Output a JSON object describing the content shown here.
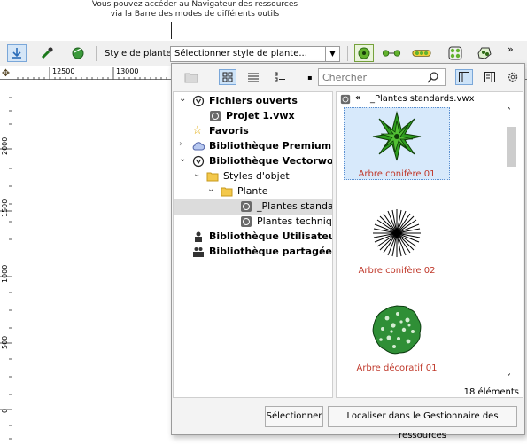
{
  "callout": {
    "line1": "Vous pouvez accéder au Navigateur des ressources",
    "line2": "via la Barre des modes de différents outils"
  },
  "toolbar": {
    "style_label": "Style de plante:",
    "style_value": "Sélectionner style de plante...",
    "overflow": "»"
  },
  "ruler": {
    "h_labels": [
      "12500",
      "13000"
    ],
    "v_labels": [
      "2000",
      "1500",
      "1000",
      "500",
      "0"
    ]
  },
  "panel": {
    "search_placeholder": "Chercher",
    "tree": [
      {
        "label": "Fichiers ouverts",
        "bold": true,
        "icon": "vectorworks-logo-icon"
      },
      {
        "label": "Projet 1.vwx",
        "bold": true,
        "icon": "vwx-file-icon"
      },
      {
        "label": "Favoris",
        "bold": true,
        "icon": "star-icon"
      },
      {
        "label": "Bibliothèque Premium",
        "bold": true,
        "icon": "cloud-icon"
      },
      {
        "label": "Bibliothèque Vectorworks",
        "bold": true,
        "icon": "vectorworks-logo-icon"
      },
      {
        "label": "Styles d'objet",
        "bold": false,
        "icon": "folder-icon"
      },
      {
        "label": "Plante",
        "bold": false,
        "icon": "folder-icon"
      },
      {
        "label": "_Plantes standards.vwx",
        "bold": false,
        "icon": "vwx-file-icon"
      },
      {
        "label": "Plantes techniques.vwx",
        "bold": false,
        "icon": "vwx-file-icon"
      },
      {
        "label": "Bibliothèque Utilisateur",
        "bold": true,
        "icon": "user-library-icon"
      },
      {
        "label": "Bibliothèque partagée",
        "bold": true,
        "icon": "shared-library-icon"
      }
    ],
    "path_arrow": "«",
    "path_file": "_Plantes standards.vwx",
    "items": [
      {
        "caption": "Arbre conifère 01",
        "icon": "conifer-green-icon",
        "selected": true
      },
      {
        "caption": "Arbre conifère 02",
        "icon": "conifer-line-icon",
        "selected": false
      },
      {
        "caption": "Arbre décoratif 01",
        "icon": "decorative-tree-icon",
        "selected": false
      }
    ],
    "count": "18 éléments",
    "select_button": "Sélectionner",
    "locate_button": "Localiser dans le Gestionnaire des ressources"
  },
  "colors": {
    "caption": "#c0392b",
    "selection": "#d7e9fb",
    "tree_highlight": "#dcdcdc",
    "plant_green": "#2e9e1f"
  }
}
